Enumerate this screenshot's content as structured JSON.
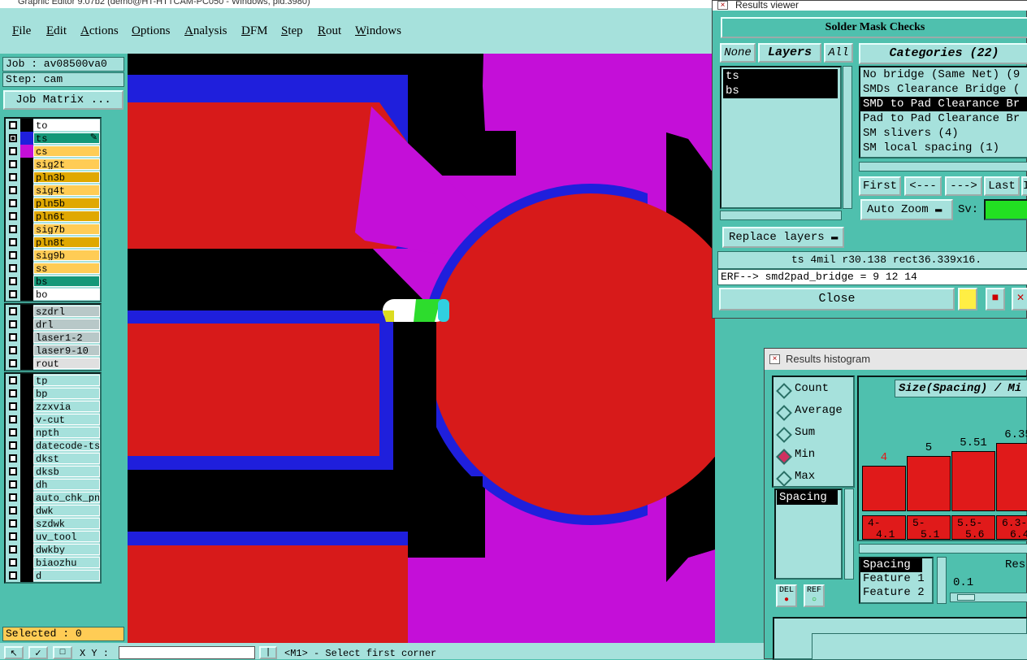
{
  "window_title": "Graphic Editor 9.07b2 (demo@HT-HTTCAM-PC050 - Windows, pid.3980)",
  "menu": [
    "File",
    "Edit",
    "Actions",
    "Options",
    "Analysis",
    "DFM",
    "Step",
    "Rout",
    "Windows"
  ],
  "job": {
    "label": "Job : av08500va0",
    "step": "Step: cam",
    "matrix_button": "Job Matrix ..."
  },
  "layer_groups": [
    [
      {
        "name": "to",
        "color": "#000000",
        "bg": "#ffffff",
        "checked": false
      },
      {
        "name": "ts",
        "color": "#1f1fdc",
        "bg": "#149878",
        "checked": true,
        "active": true
      },
      {
        "name": "cs",
        "color": "#c40fd8",
        "bg": "#ffcc55",
        "checked": false
      },
      {
        "name": "sig2t",
        "color": "#000000",
        "bg": "#ffcc55",
        "checked": false
      },
      {
        "name": "pln3b",
        "color": "#000000",
        "bg": "#e0a800",
        "checked": false
      },
      {
        "name": "sig4t",
        "color": "#000000",
        "bg": "#ffcc55",
        "checked": false
      },
      {
        "name": "pln5b",
        "color": "#000000",
        "bg": "#e0a800",
        "checked": false
      },
      {
        "name": "pln6t",
        "color": "#000000",
        "bg": "#e0a800",
        "checked": false
      },
      {
        "name": "sig7b",
        "color": "#000000",
        "bg": "#ffcc55",
        "checked": false
      },
      {
        "name": "pln8t",
        "color": "#000000",
        "bg": "#e0a800",
        "checked": false
      },
      {
        "name": "sig9b",
        "color": "#000000",
        "bg": "#ffcc55",
        "checked": false
      },
      {
        "name": "ss",
        "color": "#000000",
        "bg": "#ffcc55",
        "checked": false
      },
      {
        "name": "bs",
        "color": "#000000",
        "bg": "#149878",
        "checked": false
      },
      {
        "name": "bo",
        "color": "#000000",
        "bg": "#ffffff",
        "checked": false
      }
    ],
    [
      {
        "name": "szdrl",
        "color": "#000000",
        "bg": "#b8c8c8",
        "checked": false
      },
      {
        "name": "drl",
        "color": "#000000",
        "bg": "#b8c8c8",
        "checked": false
      },
      {
        "name": "laser1-2",
        "color": "#000000",
        "bg": "#b8c8c8",
        "checked": false
      },
      {
        "name": "laser9-10",
        "color": "#000000",
        "bg": "#b8c8c8",
        "checked": false
      },
      {
        "name": "rout",
        "color": "#000000",
        "bg": "#e0e0e0",
        "checked": false
      }
    ],
    [
      {
        "name": "tp",
        "color": "#000000",
        "bg": "#a6e1dc",
        "checked": false
      },
      {
        "name": "bp",
        "color": "#000000",
        "bg": "#a6e1dc",
        "checked": false
      },
      {
        "name": "zzxvia",
        "color": "#000000",
        "bg": "#a6e1dc",
        "checked": false
      },
      {
        "name": "v-cut",
        "color": "#000000",
        "bg": "#a6e1dc",
        "checked": false
      },
      {
        "name": "npth",
        "color": "#000000",
        "bg": "#a6e1dc",
        "checked": false
      },
      {
        "name": "datecode-ts",
        "color": "#000000",
        "bg": "#a6e1dc",
        "checked": false
      },
      {
        "name": "dkst",
        "color": "#000000",
        "bg": "#a6e1dc",
        "checked": false
      },
      {
        "name": "dksb",
        "color": "#000000",
        "bg": "#a6e1dc",
        "checked": false
      },
      {
        "name": "dh",
        "color": "#000000",
        "bg": "#a6e1dc",
        "checked": false
      },
      {
        "name": "auto_chk_pn.",
        "color": "#000000",
        "bg": "#a6e1dc",
        "checked": false
      },
      {
        "name": "dwk",
        "color": "#000000",
        "bg": "#a6e1dc",
        "checked": false
      },
      {
        "name": "szdwk",
        "color": "#000000",
        "bg": "#a6e1dc",
        "checked": false
      },
      {
        "name": "uv_tool",
        "color": "#000000",
        "bg": "#a6e1dc",
        "checked": false
      },
      {
        "name": "dwkby",
        "color": "#000000",
        "bg": "#a6e1dc",
        "checked": false
      },
      {
        "name": "biaozhu",
        "color": "#000000",
        "bg": "#a6e1dc",
        "checked": false
      },
      {
        "name": "d",
        "color": "#000000",
        "bg": "#a6e1dc",
        "checked": false
      }
    ]
  ],
  "selected": "Selected : 0",
  "status": {
    "coord_label": "X Y :",
    "prompt": "<M1> - Select first corner"
  },
  "results_viewer": {
    "title": "Results viewer",
    "header": "Solder Mask Checks",
    "btn_none": "None",
    "btn_layers": "Layers",
    "btn_all": "All",
    "layers": [
      "ts",
      "bs"
    ],
    "categories_label": "Categories (22)",
    "categories": [
      "No bridge (Same Net) (9",
      "SMDs Clearance Bridge (",
      "SMD to Pad Clearance Br",
      "Pad to Pad Clearance Br",
      "SM slivers (4)",
      "SM local spacing (1)"
    ],
    "nav": [
      "First",
      "<---",
      "--->",
      "Last",
      "I"
    ],
    "auto_zoom": "Auto Zoom",
    "sv_label": "Sv:",
    "replace_layers": "Replace layers",
    "info_line": "ts 4mil  r30.138  rect36.339x16.",
    "erf_line": "ERF--> smd2pad_bridge = 9 12 14",
    "close": "Close"
  },
  "results_histogram": {
    "title": "Results histogram",
    "modes": [
      "Count",
      "Average",
      "Sum",
      "Min",
      "Max"
    ],
    "selected_mode": "Min",
    "axis_title": "Size(Spacing) / Mi",
    "list_items": [
      "Spacing"
    ],
    "del_label": "DEL",
    "ref_label": "REF",
    "fields": [
      "Spacing",
      "Feature 1",
      "Feature 2"
    ],
    "res_label": "Res",
    "res_value": "0.1"
  },
  "chart_data": {
    "type": "bar",
    "title": "Size(Spacing) / Mi",
    "categories": [
      "4-4.1",
      "5-5.1",
      "5.5-5.6",
      "6.3-6.4"
    ],
    "bin_labels": [
      [
        "4-",
        "4.1"
      ],
      [
        "5-",
        "5.1"
      ],
      [
        "5.5-",
        "5.6"
      ],
      [
        "6.3-",
        "6.4"
      ]
    ],
    "values": [
      4,
      5,
      5.51,
      6.35
    ],
    "value_labels": [
      "4",
      "5",
      "5.51",
      "6.35"
    ],
    "ylim": [
      0,
      8
    ],
    "colors": {
      "bar": "#e01a1a",
      "first_label": "#e01a1a"
    }
  },
  "colors": {
    "ts_layer": "#1f1fdc",
    "cs_layer": "#c40fd8",
    "pad": "#d71a1a",
    "canvas_bg": "#000000",
    "panel": "#4fc0ae",
    "panel_light": "#a6e1dc"
  }
}
